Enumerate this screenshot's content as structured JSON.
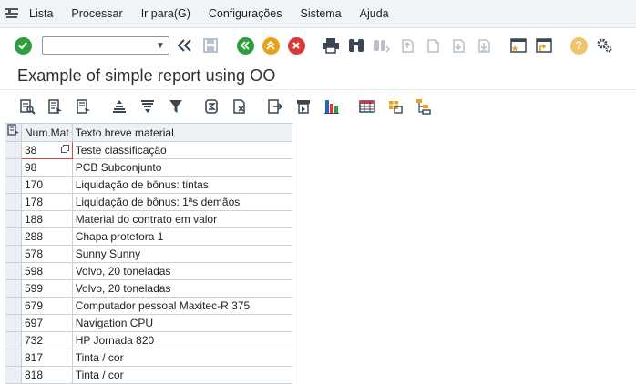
{
  "menu": {
    "items": [
      {
        "label": "Lista"
      },
      {
        "label": "Processar"
      },
      {
        "label": "Ir para(G)"
      },
      {
        "label": "Configurações"
      },
      {
        "label": "Sistema"
      },
      {
        "label": "Ajuda"
      }
    ]
  },
  "toolbar": {
    "command_field_value": "",
    "icons": [
      "enter-icon",
      "back-icon",
      "save-icon",
      "green-back-icon",
      "exit-icon",
      "cancel-icon",
      "print-icon",
      "find-icon",
      "find-next-icon",
      "first-page-icon",
      "prev-page-icon",
      "next-page-icon",
      "last-page-icon",
      "new-session-icon",
      "shortcut-icon",
      "help-icon",
      "customize-icon"
    ]
  },
  "page": {
    "title": "Example of simple report using OO"
  },
  "app_toolbar": {
    "icons": [
      "details-icon",
      "select-layout-icon",
      "choose-layout-icon",
      "sort-ascending-icon",
      "sort-descending-icon",
      "filter-icon",
      "total-icon",
      "clear-icon",
      "export-icon",
      "print-preview-icon",
      "graphic-icon",
      "view-grid-icon",
      "local-file-icon",
      "abc-analysis-icon"
    ]
  },
  "grid": {
    "columns": [
      "Num.Mat",
      "Texto breve material"
    ],
    "rows": [
      {
        "num": "38",
        "text": "Teste classificação"
      },
      {
        "num": "98",
        "text": "PCB Subconjunto"
      },
      {
        "num": "170",
        "text": "Liquidação de bônus: tintas"
      },
      {
        "num": "178",
        "text": "Liquidação de bônus: 1ªs demãos"
      },
      {
        "num": "188",
        "text": "Material do contrato em valor"
      },
      {
        "num": "288",
        "text": "Chapa protetora 1"
      },
      {
        "num": "578",
        "text": "Sunny Sunny"
      },
      {
        "num": "598",
        "text": "Volvo, 20 toneladas"
      },
      {
        "num": "599",
        "text": "Volvo, 20 toneladas"
      },
      {
        "num": "679",
        "text": "Computador pessoal Maxitec-R 375"
      },
      {
        "num": "697",
        "text": "Navigation CPU"
      },
      {
        "num": "732",
        "text": "HP Jornada 820"
      },
      {
        "num": "817",
        "text": "Tinta / cor"
      },
      {
        "num": "818",
        "text": "Tinta / cor"
      }
    ]
  },
  "colors": {
    "green": "#2e9e3e",
    "orange": "#e8a21a",
    "red": "#d73a3a",
    "icon_dark": "#3a4654"
  }
}
